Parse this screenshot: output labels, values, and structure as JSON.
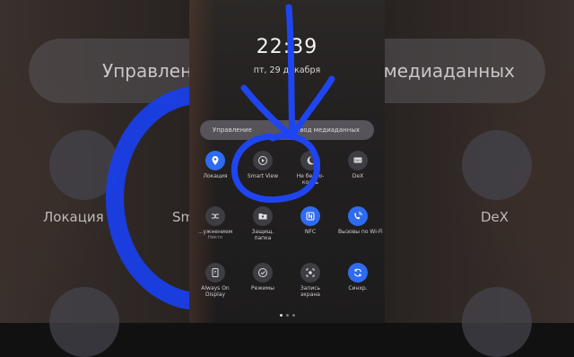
{
  "status": {
    "time": "22:39",
    "date": "пт, 29 декабря"
  },
  "media_panel": {
    "left_label": "Управление",
    "right_label": "Вывод медиаданных"
  },
  "background": {
    "left_text": "Управлени",
    "right_text": "од медиаданных",
    "labels": {
      "location": "Локация",
      "sm": "Sm",
      "dex": "DeX"
    }
  },
  "tiles": [
    {
      "label": "Локация",
      "icon": "location-pin-icon",
      "active": true
    },
    {
      "label": "Smart View",
      "icon": "smart-view-icon",
      "active": false
    },
    {
      "label": "Не беспо-\nкоить",
      "icon": "do-not-disturb-icon",
      "active": false
    },
    {
      "label": "DeX",
      "icon": "dex-icon",
      "active": false
    },
    {
      "label": "...ужнением",
      "sub": "Никто",
      "icon": "link-sharing-icon",
      "active": false
    },
    {
      "label": "Защищ.\nпапка",
      "icon": "secure-folder-icon",
      "active": false
    },
    {
      "label": "NFC",
      "icon": "nfc-icon",
      "active": true
    },
    {
      "label": "Вызовы по Wi-Fi",
      "icon": "wifi-calling-icon",
      "active": true
    },
    {
      "label": "Always On\nDisplay",
      "icon": "always-on-display-icon",
      "active": false
    },
    {
      "label": "Режимы",
      "icon": "modes-icon",
      "active": false
    },
    {
      "label": "Запись\nэкрана",
      "icon": "screen-recorder-icon",
      "active": false
    },
    {
      "label": "Синхр.",
      "icon": "sync-icon",
      "active": true
    }
  ],
  "colors": {
    "accent": "#2f6bf0",
    "annotation": "#1a3fe8"
  }
}
